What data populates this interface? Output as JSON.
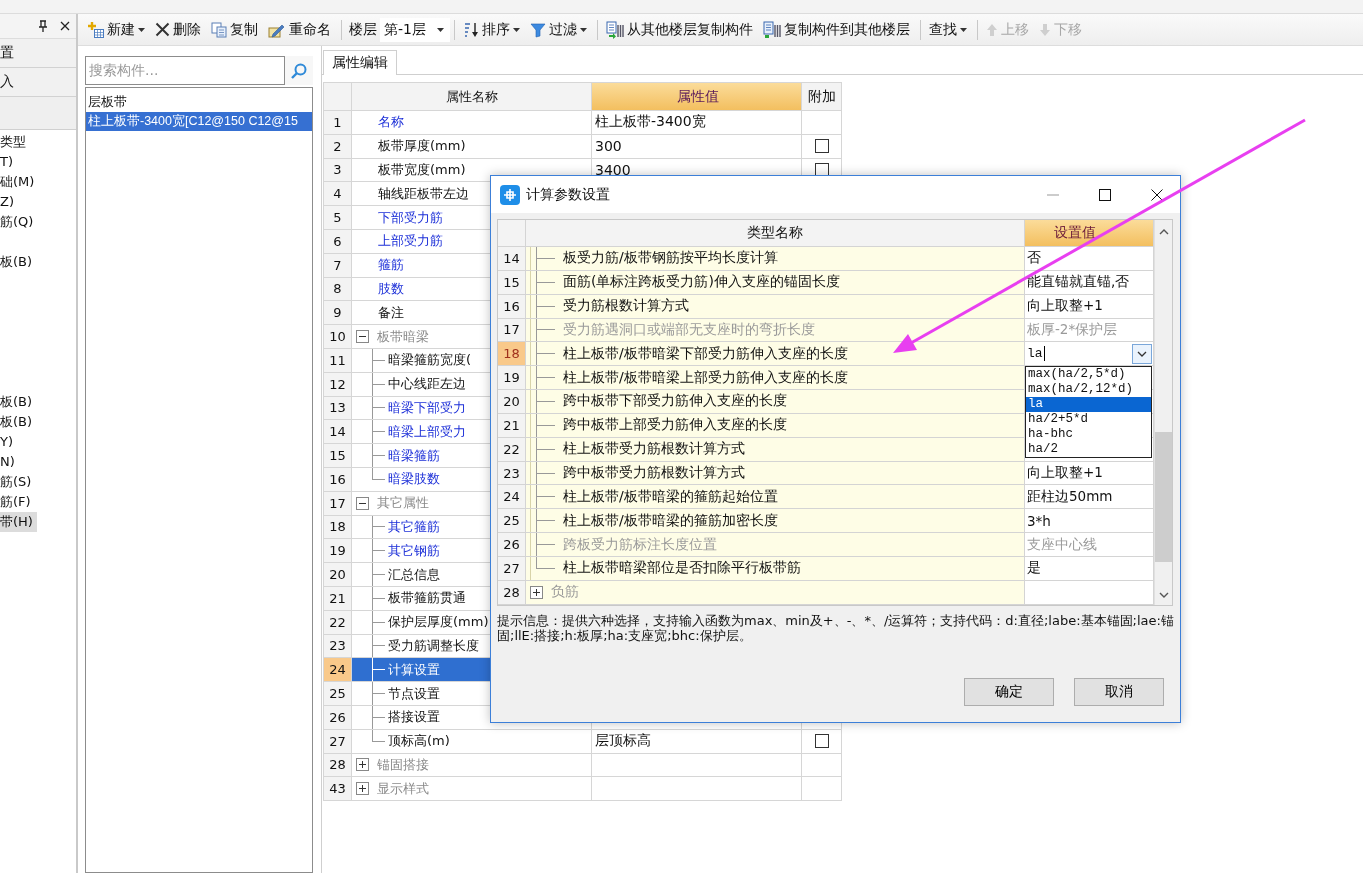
{
  "toolbar": {
    "items": [
      {
        "kind": "button",
        "label": "新建",
        "dropdown": true,
        "disabled": false
      },
      {
        "kind": "button",
        "label": "删除",
        "dropdown": false,
        "disabled": false
      },
      {
        "kind": "button",
        "label": "复制",
        "dropdown": false,
        "disabled": false
      },
      {
        "kind": "button",
        "label": "重命名",
        "dropdown": false,
        "disabled": false
      },
      {
        "kind": "separator"
      },
      {
        "kind": "label",
        "label": "楼层"
      },
      {
        "kind": "select",
        "value": "第-1层"
      },
      {
        "kind": "separator"
      },
      {
        "kind": "button",
        "label": "排序",
        "dropdown": true,
        "disabled": false
      },
      {
        "kind": "button",
        "label": "过滤",
        "dropdown": true,
        "disabled": false
      },
      {
        "kind": "separator"
      },
      {
        "kind": "button",
        "label": "从其他楼层复制构件",
        "dropdown": false,
        "disabled": false
      },
      {
        "kind": "button",
        "label": "复制构件到其他楼层",
        "dropdown": false,
        "disabled": false
      },
      {
        "kind": "separator"
      },
      {
        "kind": "button",
        "label": "查找",
        "dropdown": true,
        "disabled": false
      },
      {
        "kind": "separator"
      },
      {
        "kind": "button",
        "label": "上移",
        "dropdown": false,
        "disabled": true
      },
      {
        "kind": "button",
        "label": "下移",
        "dropdown": false,
        "disabled": true
      }
    ]
  },
  "dock_panel": {
    "tabs": [
      "置",
      "入"
    ],
    "items": [
      {
        "label": "类型",
        "selected": false
      },
      {
        "label": "T)",
        "selected": false
      },
      {
        "label": "础(M)",
        "selected": false
      },
      {
        "label": "Z)",
        "selected": false
      },
      {
        "label": "筋(Q)",
        "selected": false
      },
      {
        "label": "板(B)",
        "selected": false
      },
      {
        "label": "板(B)",
        "selected": false
      },
      {
        "label": "板(B)",
        "selected": false
      },
      {
        "label": "Y)",
        "selected": false
      },
      {
        "label": "N)",
        "selected": false
      },
      {
        "label": "筋(S)",
        "selected": false
      },
      {
        "label": "筋(F)",
        "selected": false
      },
      {
        "label": "带(H)",
        "selected": true
      }
    ]
  },
  "component_list": {
    "search": {
      "placeholder": "搜索构件..."
    },
    "items": [
      {
        "label": "层板带",
        "selected": false
      },
      {
        "label": "柱上板带-3400宽[C12@150 C12@15",
        "selected": true
      }
    ]
  },
  "property_panel": {
    "tab": {
      "label": "属性编辑",
      "selected": true
    },
    "columns": [
      "属性名称",
      "属性值",
      "附加"
    ],
    "rows": [
      {
        "num": "1",
        "name": "名称",
        "kind": "link",
        "value": "柱上板带-3400宽",
        "selected": false
      },
      {
        "num": "2",
        "name": "板带厚度(mm)",
        "kind": "text",
        "value": "300",
        "addon": {
          "checked": false
        },
        "selected": false
      },
      {
        "num": "3",
        "name": "板带宽度(mm)",
        "kind": "text",
        "value": "3400",
        "addon": {
          "checked": false
        },
        "selected": false
      },
      {
        "num": "4",
        "name": "轴线距板带左边",
        "kind": "text",
        "selected": false
      },
      {
        "num": "5",
        "name": "下部受力筋",
        "kind": "link",
        "selected": false
      },
      {
        "num": "6",
        "name": "上部受力筋",
        "kind": "link",
        "selected": false
      },
      {
        "num": "7",
        "name": "箍筋",
        "kind": "link",
        "selected": false
      },
      {
        "num": "8",
        "name": "肢数",
        "kind": "link",
        "selected": false
      },
      {
        "num": "9",
        "name": "备注",
        "kind": "text",
        "selected": false
      },
      {
        "num": "10",
        "name": "板带暗梁",
        "kind": "group",
        "expanded": true,
        "selected": false,
        "children": [
          {
            "num": "11",
            "name": "暗梁箍筋宽度(",
            "kind": "text",
            "selected": false
          },
          {
            "num": "12",
            "name": "中心线距左边",
            "kind": "text",
            "selected": false
          },
          {
            "num": "13",
            "name": "暗梁下部受力",
            "kind": "link",
            "selected": false
          },
          {
            "num": "14",
            "name": "暗梁上部受力",
            "kind": "link",
            "selected": false
          },
          {
            "num": "15",
            "name": "暗梁箍筋",
            "kind": "link",
            "selected": false
          },
          {
            "num": "16",
            "name": "暗梁肢数",
            "kind": "link",
            "selected": false
          }
        ]
      },
      {
        "num": "17",
        "name": "其它属性",
        "kind": "group",
        "expanded": true,
        "selected": false,
        "children": [
          {
            "num": "18",
            "name": "其它箍筋",
            "kind": "link",
            "selected": false
          },
          {
            "num": "19",
            "name": "其它钢筋",
            "kind": "link",
            "selected": false
          },
          {
            "num": "20",
            "name": "汇总信息",
            "kind": "text",
            "selected": false
          },
          {
            "num": "21",
            "name": "板带箍筋贯通",
            "kind": "text",
            "selected": false
          },
          {
            "num": "22",
            "name": "保护层厚度(mm)",
            "kind": "text",
            "selected": false
          },
          {
            "num": "23",
            "name": "受力筋调整长度",
            "kind": "text",
            "selected": false
          },
          {
            "num": "24",
            "name": "计算设置",
            "kind": "text",
            "selected": true
          },
          {
            "num": "25",
            "name": "节点设置",
            "kind": "text",
            "selected": false
          },
          {
            "num": "26",
            "name": "搭接设置",
            "kind": "text",
            "selected": false
          },
          {
            "num": "27",
            "name": "顶标高(m)",
            "kind": "text",
            "value": "层顶标高",
            "addon": {
              "checked": false
            },
            "selected": false
          }
        ]
      },
      {
        "num": "28",
        "name": "锚固搭接",
        "kind": "group",
        "expanded": false,
        "selected": false
      },
      {
        "num": "43",
        "name": "显示样式",
        "kind": "group",
        "expanded": false,
        "selected": false
      }
    ]
  },
  "dialog": {
    "title": "计算参数设置",
    "columns": [
      "类型名称",
      "设置值"
    ],
    "rows": [
      {
        "num": "14",
        "name": "板受力筋/板带钢筋按平均长度计算",
        "kind": "setting",
        "value": "否",
        "disabled": false,
        "selected": false
      },
      {
        "num": "15",
        "name": "面筋(单标注跨板受力筋)伸入支座的锚固长度",
        "kind": "setting",
        "value": "能直锚就直锚,否",
        "disabled": false,
        "selected": false
      },
      {
        "num": "16",
        "name": "受力筋根数计算方式",
        "kind": "setting",
        "value": "向上取整+1",
        "disabled": false,
        "selected": false
      },
      {
        "num": "17",
        "name": "受力筋遇洞口或端部无支座时的弯折长度",
        "kind": "setting",
        "value": "板厚-2*保护层",
        "disabled": true,
        "selected": false
      },
      {
        "num": "18",
        "name": "柱上板带/板带暗梁下部受力筋伸入支座的长度",
        "kind": "setting",
        "value": "la",
        "disabled": false,
        "selected": true,
        "options": [
          {
            "label": "max(ha/2,5*d)",
            "selected": false
          },
          {
            "label": "max(ha/2,12*d)",
            "selected": false
          },
          {
            "label": "la",
            "selected": true
          },
          {
            "label": "ha/2+5*d",
            "selected": false
          },
          {
            "label": "ha-bhc",
            "selected": false
          },
          {
            "label": "ha/2",
            "selected": false
          }
        ]
      },
      {
        "num": "19",
        "name": "柱上板带/板带暗梁上部受力筋伸入支座的长度",
        "kind": "setting",
        "disabled": false,
        "selected": false
      },
      {
        "num": "20",
        "name": "跨中板带下部受力筋伸入支座的长度",
        "kind": "setting",
        "disabled": false,
        "selected": false
      },
      {
        "num": "21",
        "name": "跨中板带上部受力筋伸入支座的长度",
        "kind": "setting",
        "disabled": false,
        "selected": false
      },
      {
        "num": "22",
        "name": "柱上板带受力筋根数计算方式",
        "kind": "setting",
        "disabled": false,
        "selected": false
      },
      {
        "num": "23",
        "name": "跨中板带受力筋根数计算方式",
        "kind": "setting",
        "value": "向上取整+1",
        "disabled": false,
        "selected": false
      },
      {
        "num": "24",
        "name": "柱上板带/板带暗梁的箍筋起始位置",
        "kind": "setting",
        "value": "距柱边50mm",
        "disabled": false,
        "selected": false
      },
      {
        "num": "25",
        "name": "柱上板带/板带暗梁的箍筋加密长度",
        "kind": "setting",
        "value": "3*h",
        "disabled": false,
        "selected": false
      },
      {
        "num": "26",
        "name": "跨板受力筋标注长度位置",
        "kind": "setting",
        "value": "支座中心线",
        "disabled": true,
        "selected": false
      },
      {
        "num": "27",
        "name": "柱上板带暗梁部位是否扣除平行板带筋",
        "kind": "setting",
        "value": "是",
        "disabled": false,
        "selected": false
      },
      {
        "num": "28",
        "name": "负筋",
        "kind": "group",
        "expanded": false,
        "disabled": true,
        "selected": false
      }
    ],
    "hint": "提示信息：提供六种选择，支持输入函数为max、min及+、-、*、/运算符；支持代码：d:直径;labe:基本锚固;lae:锚固;llE:搭接;h:板厚;ha:支座宽;bhc:保护层。",
    "buttons": [
      "确定",
      "取消"
    ]
  }
}
